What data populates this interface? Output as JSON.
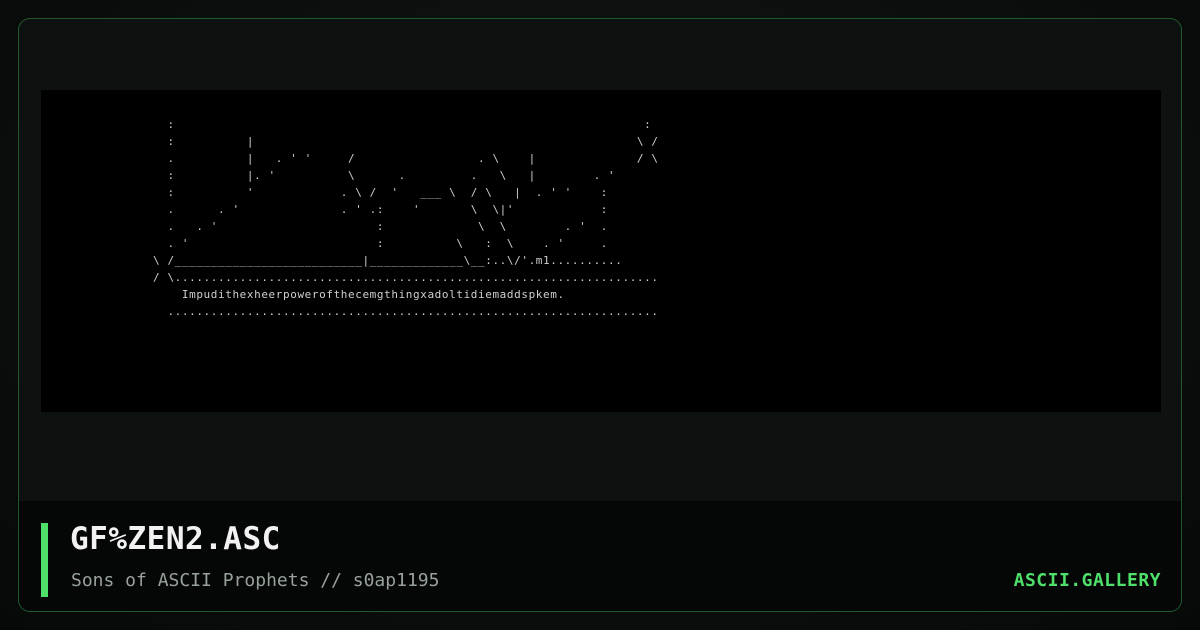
{
  "artwork": {
    "ascii": "  :                                                                 :\n  :          |                                                     \\ /\n  .          |   . ' '     /                 . \\    |              / \\\n  :          |. '          \\      .         .   \\   |        . '\n  :          '            . \\ /  '   ___ \\  / \\   |  . ' '    :\n  .      . '              . ' .:    '       \\  \\|'            :\n  .   . '                      :             \\  \\        . '  .\n  . '                          :          \\   :  \\    . '     .\n\\ /__________________________|_____________\\__:..\\/'.m1..........\n/ \\...................................................................\n    Impudithexheerpowerofthecemgthingxadoltidiemaddspkem.\n  ...................................................................."
  },
  "footer": {
    "title": "GF%ZEN2.ASC",
    "subtitle": "Sons of ASCII Prophets // s0ap1195",
    "brand": "ASCII.GALLERY"
  },
  "colors": {
    "accent": "#4ee06a",
    "frame_border": "#1f5a2c",
    "art_text": "#cfcfcf",
    "title": "#f2f2f2",
    "subtitle": "#98a29b"
  }
}
